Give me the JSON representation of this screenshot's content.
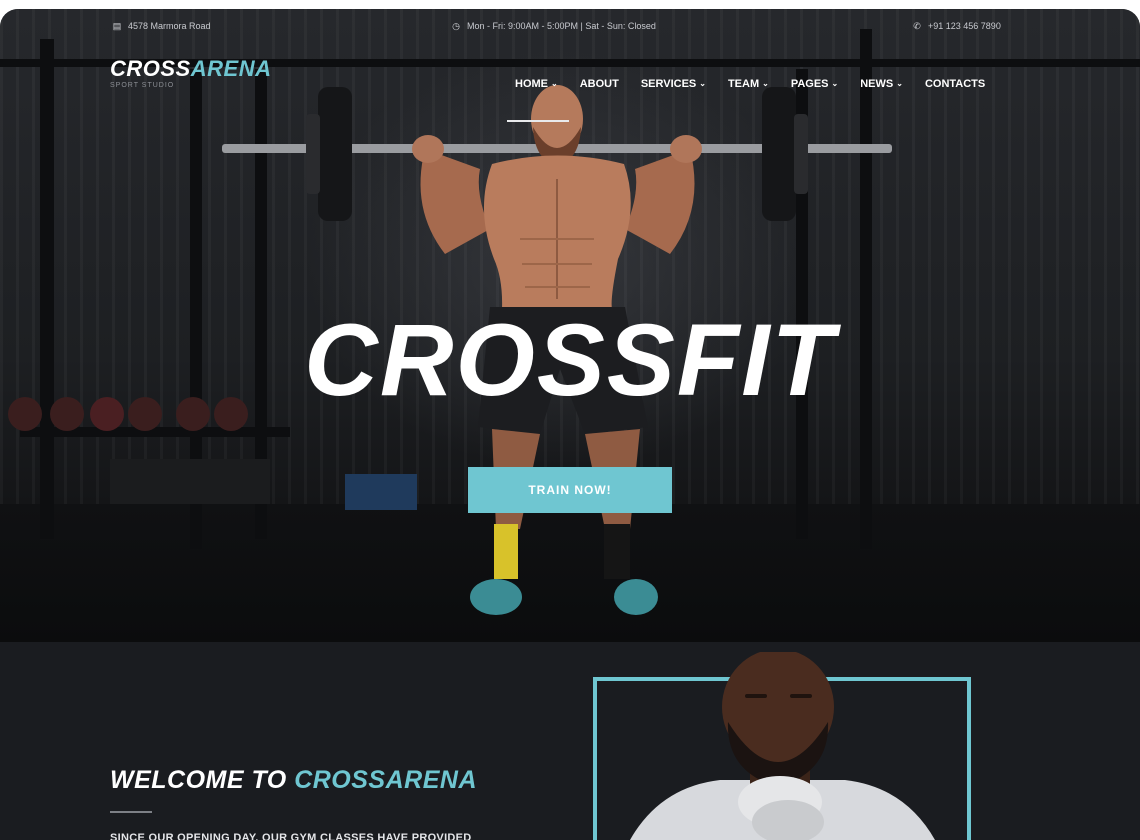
{
  "topbar": {
    "address": "4578 Marmora Road",
    "hours": "Mon - Fri: 9:00AM - 5:00PM  |  Sat - Sun: Closed",
    "phone": "+91 123 456 7890",
    "address_icon": "calendar-icon",
    "hours_icon": "clock-icon",
    "phone_icon": "phone-icon"
  },
  "logo": {
    "part1": "CROSS",
    "part2": "ARENA",
    "subtitle": "SPORT STUDIO"
  },
  "nav": {
    "items": [
      {
        "label": "HOME",
        "dropdown": true,
        "active": true
      },
      {
        "label": "ABOUT",
        "dropdown": false
      },
      {
        "label": "SERVICES",
        "dropdown": true
      },
      {
        "label": "TEAM",
        "dropdown": true
      },
      {
        "label": "PAGES",
        "dropdown": true
      },
      {
        "label": "NEWS",
        "dropdown": true
      },
      {
        "label": "CONTACTS",
        "dropdown": false
      }
    ]
  },
  "hero": {
    "title": "CROSSFIT",
    "cta_label": "TRAIN NOW!"
  },
  "about": {
    "welcome_part1": "WELCOME TO ",
    "welcome_part2": "CROSSARENA",
    "text": "SINCE OUR OPENING DAY, OUR GYM CLASSES HAVE PROVIDED"
  },
  "colors": {
    "accent": "#6fc6d1",
    "dark": "#1a1c20",
    "text": "#ffffff"
  }
}
